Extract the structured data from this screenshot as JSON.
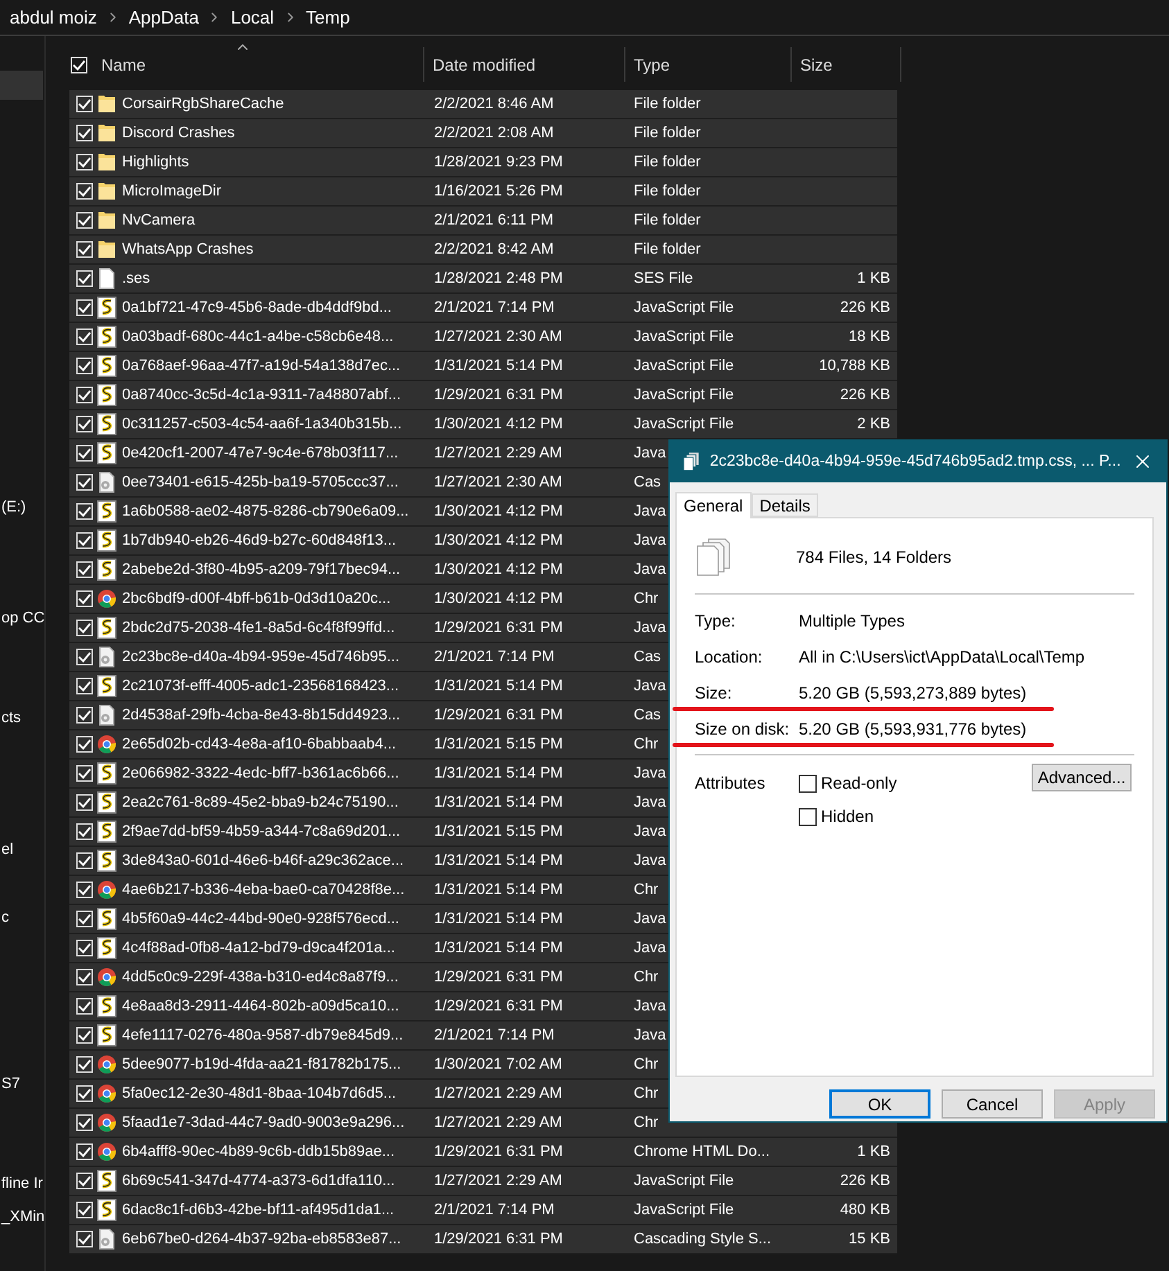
{
  "breadcrumb": [
    "abdul moiz",
    "AppData",
    "Local",
    "Temp"
  ],
  "sidebar": {
    "items": [
      "(E:)",
      "op CC",
      "cts",
      "el",
      "c",
      "S7",
      "fline Ir",
      "_XMin"
    ]
  },
  "columns": [
    {
      "label": "Name",
      "sorted": true
    },
    {
      "label": "Date modified"
    },
    {
      "label": "Type"
    },
    {
      "label": "Size"
    }
  ],
  "select_all": {
    "checked": true
  },
  "rows": [
    {
      "name": "CorsairRgbShareCache",
      "date": "2/2/2021 8:46 AM",
      "type": "File folder",
      "kind": "folder",
      "checked": true
    },
    {
      "name": "Discord Crashes",
      "date": "2/2/2021 2:08 AM",
      "type": "File folder",
      "kind": "folder",
      "checked": true
    },
    {
      "name": "Highlights",
      "date": "1/28/2021 9:23 PM",
      "type": "File folder",
      "kind": "folder",
      "checked": true
    },
    {
      "name": "MicroImageDir",
      "date": "1/16/2021 5:26 PM",
      "type": "File folder",
      "kind": "folder",
      "checked": true
    },
    {
      "name": "NvCamera",
      "date": "2/1/2021 6:11 PM",
      "type": "File folder",
      "kind": "folder",
      "checked": true
    },
    {
      "name": "WhatsApp Crashes",
      "date": "2/2/2021 8:42 AM",
      "type": "File folder",
      "kind": "folder",
      "checked": true
    },
    {
      "name": ".ses",
      "date": "1/28/2021 2:48 PM",
      "type": "SES File",
      "size": "1 KB",
      "kind": "file",
      "checked": true
    },
    {
      "name": "0a1bf721-47c9-45b6-8ade-db4ddf9bd...",
      "date": "2/1/2021 7:14 PM",
      "type": "JavaScript File",
      "size": "226 KB",
      "kind": "script",
      "checked": true
    },
    {
      "name": "0a03badf-680c-44c1-a4be-c58cb6e48...",
      "date": "1/27/2021 2:30 AM",
      "type": "JavaScript File",
      "size": "18 KB",
      "kind": "script",
      "checked": true
    },
    {
      "name": "0a768aef-96aa-47f7-a19d-54a138d7ec...",
      "date": "1/31/2021 5:14 PM",
      "type": "JavaScript File",
      "size": "10,788 KB",
      "kind": "script",
      "checked": true
    },
    {
      "name": "0a8740cc-3c5d-4c1a-9311-7a48807abf...",
      "date": "1/29/2021 6:31 PM",
      "type": "JavaScript File",
      "size": "226 KB",
      "kind": "script",
      "checked": true
    },
    {
      "name": "0c311257-c503-4c54-aa6f-1a340b315b...",
      "date": "1/30/2021 4:12 PM",
      "type": "JavaScript File",
      "size": "2 KB",
      "kind": "script",
      "checked": true
    },
    {
      "name": "0e420cf1-2007-47e7-9c4e-678b03f117...",
      "date": "1/27/2021 2:29 AM",
      "type": "Java",
      "kind": "script",
      "checked": true
    },
    {
      "name": "0ee73401-e615-425b-ba19-5705ccc37...",
      "date": "1/27/2021 2:30 AM",
      "type": "Cas",
      "kind": "style",
      "checked": true
    },
    {
      "name": "1a6b0588-ae02-4875-8286-cb790e6a09...",
      "date": "1/30/2021 4:12 PM",
      "type": "Java",
      "kind": "script",
      "checked": true
    },
    {
      "name": "1b7db940-eb26-46d9-b27c-60d848f13...",
      "date": "1/30/2021 4:12 PM",
      "type": "Java",
      "kind": "script",
      "checked": true
    },
    {
      "name": "2abebe2d-3f80-4b95-a209-79f17bec94...",
      "date": "1/30/2021 4:12 PM",
      "type": "Java",
      "kind": "script",
      "checked": true
    },
    {
      "name": "2bc6bdf9-d00f-4bff-b61b-0d3d10a20c...",
      "date": "1/30/2021 4:12 PM",
      "type": "Chr",
      "kind": "browser",
      "checked": true
    },
    {
      "name": "2bdc2d75-2038-4fe1-8a5d-6c4f8f99ffd...",
      "date": "1/29/2021 6:31 PM",
      "type": "Java",
      "kind": "script",
      "checked": true
    },
    {
      "name": "2c23bc8e-d40a-4b94-959e-45d746b95...",
      "date": "2/1/2021 7:14 PM",
      "type": "Cas",
      "kind": "style",
      "checked": true
    },
    {
      "name": "2c21073f-efff-4005-adc1-23568168423...",
      "date": "1/31/2021 5:14 PM",
      "type": "Java",
      "kind": "script",
      "checked": true
    },
    {
      "name": "2d4538af-29fb-4cba-8e43-8b15dd4923...",
      "date": "1/29/2021 6:31 PM",
      "type": "Cas",
      "kind": "style",
      "checked": true
    },
    {
      "name": "2e65d02b-cd43-4e8a-af10-6babbaab4...",
      "date": "1/31/2021 5:15 PM",
      "type": "Chr",
      "kind": "browser",
      "checked": true
    },
    {
      "name": "2e066982-3322-4edc-bff7-b361ac6b66...",
      "date": "1/31/2021 5:14 PM",
      "type": "Java",
      "kind": "script",
      "checked": true
    },
    {
      "name": "2ea2c761-8c89-45e2-bba9-b24c75190...",
      "date": "1/31/2021 5:14 PM",
      "type": "Java",
      "kind": "script",
      "checked": true
    },
    {
      "name": "2f9ae7dd-bf59-4b59-a344-7c8a69d201...",
      "date": "1/31/2021 5:15 PM",
      "type": "Java",
      "kind": "script",
      "checked": true
    },
    {
      "name": "3de843a0-601d-46e6-b46f-a29c362ace...",
      "date": "1/31/2021 5:14 PM",
      "type": "Java",
      "kind": "script",
      "checked": true
    },
    {
      "name": "4ae6b217-b336-4eba-bae0-ca70428f8e...",
      "date": "1/31/2021 5:14 PM",
      "type": "Chr",
      "kind": "browser",
      "checked": true
    },
    {
      "name": "4b5f60a9-44c2-44bd-90e0-928f576ecd...",
      "date": "1/31/2021 5:14 PM",
      "type": "Java",
      "kind": "script",
      "checked": true
    },
    {
      "name": "4c4f88ad-0fb8-4a12-bd79-d9ca4f201a...",
      "date": "1/31/2021 5:14 PM",
      "type": "Java",
      "kind": "script",
      "checked": true
    },
    {
      "name": "4dd5c0c9-229f-438a-b310-ed4c8a87f9...",
      "date": "1/29/2021 6:31 PM",
      "type": "Chr",
      "kind": "browser",
      "checked": true
    },
    {
      "name": "4e8aa8d3-2911-4464-802b-a09d5ca10...",
      "date": "1/29/2021 6:31 PM",
      "type": "Java",
      "kind": "script",
      "checked": true
    },
    {
      "name": "4efe1117-0276-480a-9587-db79e845d9...",
      "date": "2/1/2021 7:14 PM",
      "type": "Java",
      "kind": "script",
      "checked": true
    },
    {
      "name": "5dee9077-b19d-4fda-aa21-f81782b175...",
      "date": "1/30/2021 7:02 AM",
      "type": "Chr",
      "kind": "browser",
      "checked": true
    },
    {
      "name": "5fa0ec12-2e30-48d1-8baa-104b7d6d5...",
      "date": "1/27/2021 2:29 AM",
      "type": "Chr",
      "kind": "browser",
      "checked": true
    },
    {
      "name": "5faad1e7-3dad-44c7-9ad0-9003e9a296...",
      "date": "1/27/2021 2:29 AM",
      "type": "Chr",
      "kind": "browser",
      "checked": true
    },
    {
      "name": "6b4afff8-90ec-4b89-9c6b-ddb15b89ae...",
      "date": "1/29/2021 6:31 PM",
      "type": "Chrome HTML Do...",
      "size": "1 KB",
      "kind": "browser",
      "checked": true
    },
    {
      "name": "6b69c541-347d-4774-a373-6d1dfa110...",
      "date": "1/27/2021 2:29 AM",
      "type": "JavaScript File",
      "size": "226 KB",
      "kind": "script",
      "checked": true
    },
    {
      "name": "6dac8c1f-d6b3-42be-bf11-af495d1da1...",
      "date": "2/1/2021 7:14 PM",
      "type": "JavaScript File",
      "size": "480 KB",
      "kind": "script",
      "checked": true
    },
    {
      "name": "6eb67be0-d264-4b37-92ba-eb8583e87...",
      "date": "1/29/2021 6:31 PM",
      "type": "Cascading Style S...",
      "size": "15 KB",
      "kind": "style",
      "checked": true
    }
  ],
  "dialog": {
    "title": "2c23bc8e-d40a-4b94-959e-45d746b95ad2.tmp.css, ... P...",
    "tabs": [
      {
        "label": "General",
        "selected": true
      },
      {
        "label": "Details",
        "selected": false
      }
    ],
    "summary": "784 Files, 14 Folders",
    "properties": [
      {
        "label": "Type:",
        "value": "Multiple Types",
        "underlined": false
      },
      {
        "label": "Location:",
        "value": "All in C:\\Users\\ict\\AppData\\Local\\Temp",
        "underlined": false
      },
      {
        "label": "Size:",
        "value": "5.20 GB (5,593,273,889 bytes)",
        "underlined": true
      },
      {
        "label": "Size on disk:",
        "value": "5.20 GB (5,593,931,776 bytes)",
        "underlined": true
      }
    ],
    "attributes_label": "Attributes",
    "attributes": [
      {
        "label": "Read-only",
        "checked": false
      },
      {
        "label": "Hidden",
        "checked": false
      }
    ],
    "advanced_button": "Advanced...",
    "buttons": [
      {
        "label": "OK",
        "default": true,
        "disabled": false
      },
      {
        "label": "Cancel",
        "default": false,
        "disabled": false
      },
      {
        "label": "Apply",
        "default": false,
        "disabled": true
      }
    ]
  }
}
